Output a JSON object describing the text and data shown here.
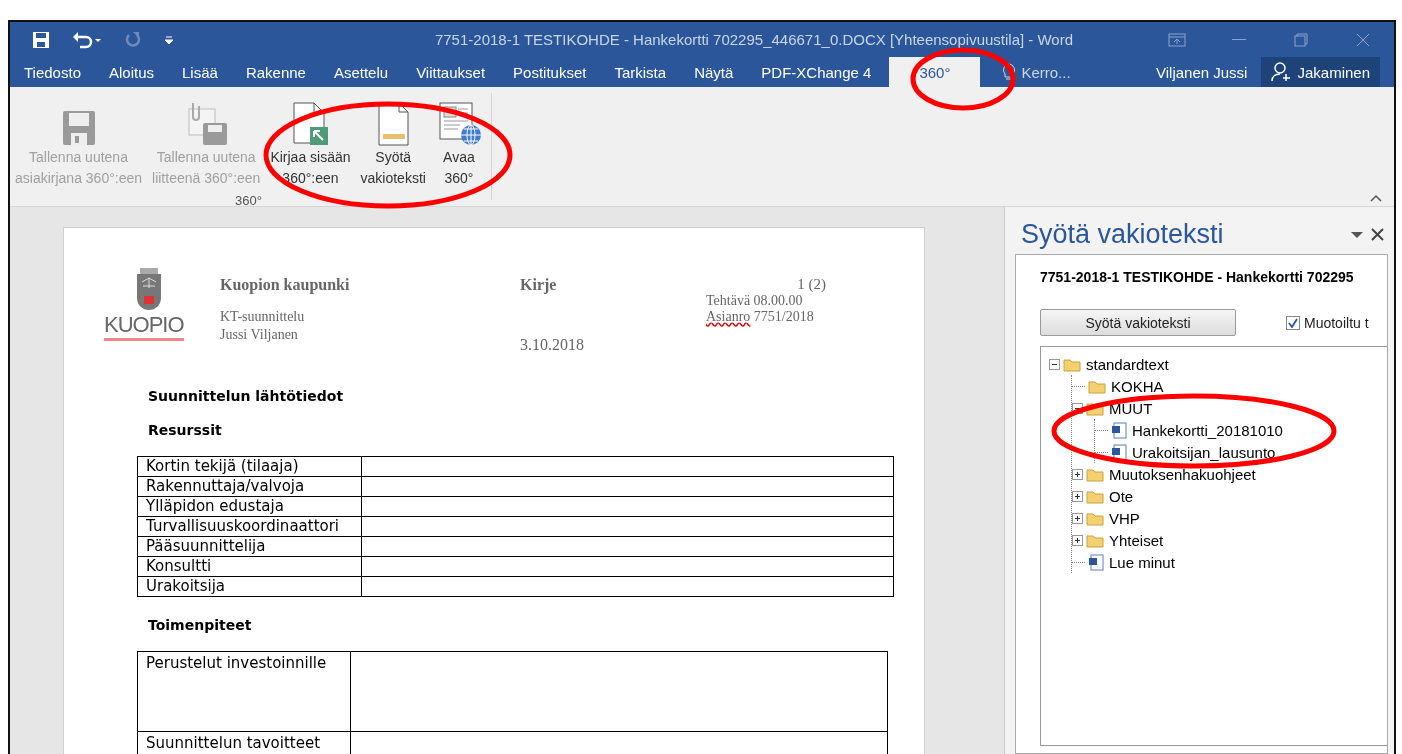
{
  "window": {
    "title": "7751-2018-1 TESTIKOHDE - Hankekortti 702295_446671_0.DOCX [Yhteensopivuustila] - Word"
  },
  "tabs": [
    {
      "label": "Tiedosto",
      "selected": false
    },
    {
      "label": "Aloitus",
      "selected": false
    },
    {
      "label": "Lisää",
      "selected": false
    },
    {
      "label": "Rakenne",
      "selected": false
    },
    {
      "label": "Asettelu",
      "selected": false
    },
    {
      "label": "Viittaukset",
      "selected": false
    },
    {
      "label": "Postitukset",
      "selected": false
    },
    {
      "label": "Tarkista",
      "selected": false
    },
    {
      "label": "Näytä",
      "selected": false
    },
    {
      "label": "PDF-XChange 4",
      "selected": false
    },
    {
      "label": "360°",
      "selected": true
    }
  ],
  "tell_me": "Kerro...",
  "account": {
    "user": "Viljanen Jussi",
    "share": "Jakaminen"
  },
  "ribbon": {
    "group_label": "360°",
    "buttons": [
      {
        "kind": "save",
        "lines": [
          "Tallenna uutena",
          "asiakirjana 360°:een"
        ],
        "disabled": true
      },
      {
        "kind": "attach",
        "lines": [
          "Tallenna uutena",
          "liitteenä 360°:een"
        ],
        "disabled": true
      },
      {
        "kind": "checkin",
        "lines": [
          "Kirjaa sisään",
          "360°:een"
        ],
        "disabled": false
      },
      {
        "kind": "insert",
        "lines": [
          "Syötä",
          "vakioteksti"
        ],
        "disabled": false
      },
      {
        "kind": "open",
        "lines": [
          "Avaa",
          "360°"
        ],
        "disabled": false
      }
    ]
  },
  "document": {
    "logo_text": "KUOPIO",
    "organization": "Kuopion kaupunki",
    "unit": "KT-suunnittelu",
    "person": "Jussi Viljanen",
    "doc_type": "Kirje",
    "date": "3.10.2018",
    "page": "1 (2)",
    "refs": [
      {
        "label": "Tehtävä",
        "value": "08.00.00",
        "misspelled": false
      },
      {
        "label": "Asianro",
        "value": "7751/2018",
        "misspelled": true
      }
    ],
    "heading": "Suunnittelun lähtötiedot",
    "resources_heading": "Resurssit",
    "resources": [
      "Kortin tekijä (tilaaja)",
      "Rakennuttaja/valvoja",
      "Ylläpidon edustaja",
      "Turvallisuuskoordinaattori",
      "Pääsuunnittelija",
      "Konsultti",
      "Urakoitsija"
    ],
    "actions_heading": "Toimenpiteet",
    "actions": [
      {
        "label": "Perustelut investoinnille",
        "kind": "tall"
      },
      {
        "label": "Suunnittelun tavoitteet",
        "kind": "normal"
      }
    ]
  },
  "task_pane": {
    "title": "Syötä vakioteksti",
    "document_name": "7751-2018-1 TESTIKOHDE - Hankekortti 702295",
    "insert_button": "Syötä vakioteksti",
    "formatted": {
      "label": "Muotoiltu t",
      "checked": true
    },
    "tree": [
      {
        "label": "standardtext",
        "kind": "folder",
        "expanded": true,
        "children": [
          {
            "label": "KOKHA",
            "kind": "folder"
          },
          {
            "label": "MUUT",
            "kind": "folder",
            "expanded": true,
            "children": [
              {
                "label": "Hankekortti_20181010",
                "kind": "document"
              },
              {
                "label": "Urakoitsijan_lausunto",
                "kind": "document"
              }
            ]
          },
          {
            "label": "Muutoksenhakuohjeet",
            "kind": "folder",
            "expanded": false
          },
          {
            "label": "Ote",
            "kind": "folder",
            "expanded": false
          },
          {
            "label": "VHP",
            "kind": "folder",
            "expanded": false
          },
          {
            "label": "Yhteiset",
            "kind": "folder",
            "expanded": false
          },
          {
            "label": "Lue minut",
            "kind": "document"
          }
        ]
      }
    ]
  }
}
